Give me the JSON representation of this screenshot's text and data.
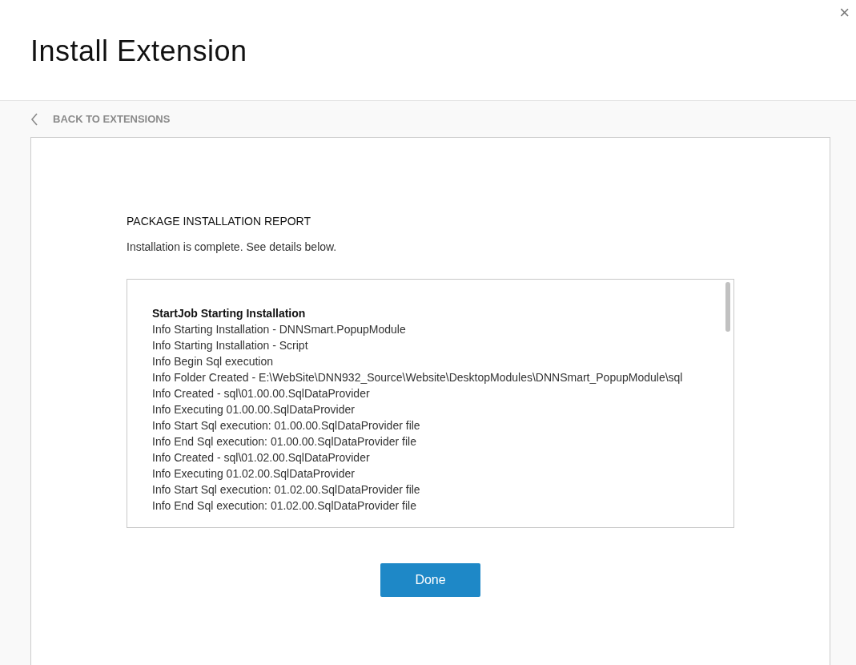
{
  "dialog": {
    "title": "Install Extension",
    "close": "×"
  },
  "back_link": {
    "label": "BACK TO EXTENSIONS"
  },
  "report": {
    "title": "PACKAGE INSTALLATION REPORT",
    "message": "Installation is complete. See details below.",
    "log": [
      {
        "kind": "header",
        "text": "StartJob Starting Installation"
      },
      {
        "kind": "entry",
        "text": "Info Starting Installation - DNNSmart.PopupModule"
      },
      {
        "kind": "entry",
        "text": "Info Starting Installation - Script"
      },
      {
        "kind": "entry",
        "text": "Info Begin Sql execution"
      },
      {
        "kind": "entry",
        "text": "Info Folder Created - E:\\WebSite\\DNN932_Source\\Website\\DesktopModules\\DNNSmart_PopupModule\\sql"
      },
      {
        "kind": "entry",
        "text": "Info Created - sql\\01.00.00.SqlDataProvider"
      },
      {
        "kind": "entry",
        "text": "Info Executing 01.00.00.SqlDataProvider"
      },
      {
        "kind": "entry",
        "text": "Info Start Sql execution: 01.00.00.SqlDataProvider file"
      },
      {
        "kind": "entry",
        "text": "Info End Sql execution: 01.00.00.SqlDataProvider file"
      },
      {
        "kind": "entry",
        "text": "Info Created - sql\\01.02.00.SqlDataProvider"
      },
      {
        "kind": "entry",
        "text": "Info Executing 01.02.00.SqlDataProvider"
      },
      {
        "kind": "entry",
        "text": "Info Start Sql execution: 01.02.00.SqlDataProvider file"
      },
      {
        "kind": "entry",
        "text": "Info End Sql execution: 01.02.00.SqlDataProvider file"
      }
    ]
  },
  "done_button": {
    "label": "Done"
  }
}
